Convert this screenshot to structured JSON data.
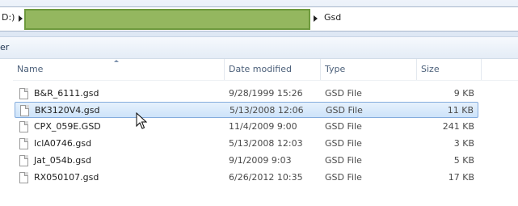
{
  "address": {
    "drive_label": "D:)",
    "current_folder": "Gsd"
  },
  "toolbar": {
    "fragment": "er"
  },
  "columns": {
    "name": "Name",
    "date": "Date modified",
    "type": "Type",
    "size": "Size"
  },
  "files": [
    {
      "name": "B&R_6111.gsd",
      "date": "9/28/1999 15:26",
      "type": "GSD File",
      "size": "9 KB"
    },
    {
      "name": "BK3120V4.gsd",
      "date": "5/13/2008 12:06",
      "type": "GSD File",
      "size": "11 KB"
    },
    {
      "name": "CPX_059E.GSD",
      "date": "11/4/2009 9:00",
      "type": "GSD File",
      "size": "241 KB"
    },
    {
      "name": "IclA0746.gsd",
      "date": "5/13/2008 12:03",
      "type": "GSD File",
      "size": "3 KB"
    },
    {
      "name": "Jat_054b.gsd",
      "date": "9/1/2009 9:03",
      "type": "GSD File",
      "size": "5 KB"
    },
    {
      "name": "RX050107.gsd",
      "date": "6/26/2012 10:35",
      "type": "GSD File",
      "size": "17 KB"
    }
  ],
  "selected_index": 1,
  "colors": {
    "selection_fill": "#cde3fa",
    "selection_border": "#84acdd",
    "redaction_box": "#94b75f"
  }
}
